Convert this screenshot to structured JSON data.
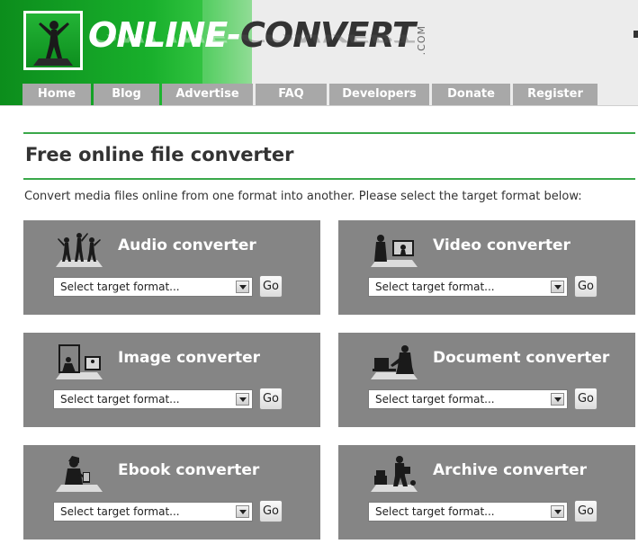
{
  "logo": {
    "part1": "ONLINE-",
    "part2": "CONVERT",
    "suffix": ".COM"
  },
  "nav": [
    {
      "label": "Home"
    },
    {
      "label": "Blog"
    },
    {
      "label": "Advertise"
    },
    {
      "label": "FAQ"
    },
    {
      "label": "Developers"
    },
    {
      "label": "Donate"
    },
    {
      "label": "Register"
    }
  ],
  "main": {
    "title": "Free online file converter",
    "intro": "Convert media files online from one format into another. Please select the target format below:"
  },
  "converters": [
    {
      "title": "Audio converter",
      "icon": "audio-icon",
      "select": "Select target format...",
      "go": "Go"
    },
    {
      "title": "Video converter",
      "icon": "video-icon",
      "select": "Select target format...",
      "go": "Go"
    },
    {
      "title": "Image converter",
      "icon": "image-icon",
      "select": "Select target format...",
      "go": "Go"
    },
    {
      "title": "Document converter",
      "icon": "document-icon",
      "select": "Select target format...",
      "go": "Go"
    },
    {
      "title": "Ebook converter",
      "icon": "ebook-icon",
      "select": "Select target format...",
      "go": "Go"
    },
    {
      "title": "Archive converter",
      "icon": "archive-icon",
      "select": "Select target format...",
      "go": "Go"
    }
  ],
  "colors": {
    "brand_green": "#19b02c",
    "nav_bg": "#a8a8a8",
    "card_bg": "#858585",
    "rule": "#3aa84a"
  }
}
